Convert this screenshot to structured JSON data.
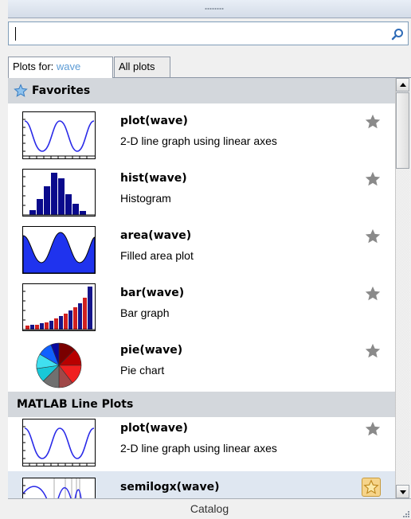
{
  "search": {
    "value": "",
    "placeholder": ""
  },
  "tabs": {
    "plots_for_prefix": "Plots for: ",
    "plots_for_var": "wave",
    "all_plots": "All plots"
  },
  "sections": {
    "favorites": "Favorites",
    "matlab_line": "MATLAB Line Plots"
  },
  "favorites": [
    {
      "title": "plot(wave)",
      "desc": "2-D line graph using linear axes",
      "icon": "line-plot-thumbnail"
    },
    {
      "title": "hist(wave)",
      "desc": "Histogram",
      "icon": "histogram-thumbnail"
    },
    {
      "title": "area(wave)",
      "desc": "Filled area plot",
      "icon": "area-plot-thumbnail"
    },
    {
      "title": "bar(wave)",
      "desc": "Bar graph",
      "icon": "bar-graph-thumbnail"
    },
    {
      "title": "pie(wave)",
      "desc": "Pie chart",
      "icon": "pie-chart-thumbnail"
    }
  ],
  "matlab_line": [
    {
      "title": "plot(wave)",
      "desc": "2-D line graph using linear axes",
      "icon": "line-plot-thumbnail"
    },
    {
      "title": "semilogx(wave)",
      "desc": "",
      "icon": "semilogx-thumbnail"
    }
  ],
  "footer": {
    "catalog": "Catalog"
  },
  "colors": {
    "accent": "#5b9bd5",
    "section_bg": "#d3d7dc",
    "selected_row": "#dfe7f1",
    "star_gray": "#8a8a8a",
    "star_gold": "#f6d48a"
  }
}
